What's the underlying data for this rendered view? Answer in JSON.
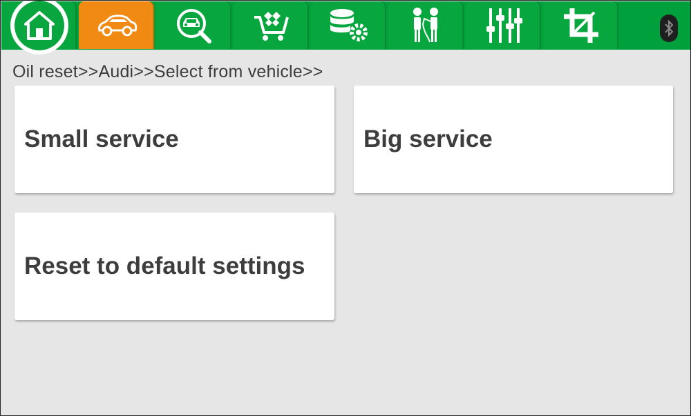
{
  "toolbar": {
    "tabs": [
      {
        "icon": "home-icon",
        "active": false
      },
      {
        "icon": "car-icon",
        "active": true
      },
      {
        "icon": "car-search-icon",
        "active": false
      },
      {
        "icon": "shopping-cart-icon",
        "active": false
      },
      {
        "icon": "database-settings-icon",
        "active": false
      },
      {
        "icon": "people-help-icon",
        "active": false
      },
      {
        "icon": "sliders-icon",
        "active": false
      },
      {
        "icon": "crop-icon",
        "active": false
      }
    ],
    "status_icon": "bluetooth-icon",
    "colors": {
      "bar": "#00a03c",
      "active": "#f08a12"
    }
  },
  "breadcrumb": "Oil reset>>Audi>>Select from vehicle>>",
  "options": [
    {
      "label": "Small service"
    },
    {
      "label": "Big service"
    },
    {
      "label": "Reset to default settings"
    }
  ]
}
